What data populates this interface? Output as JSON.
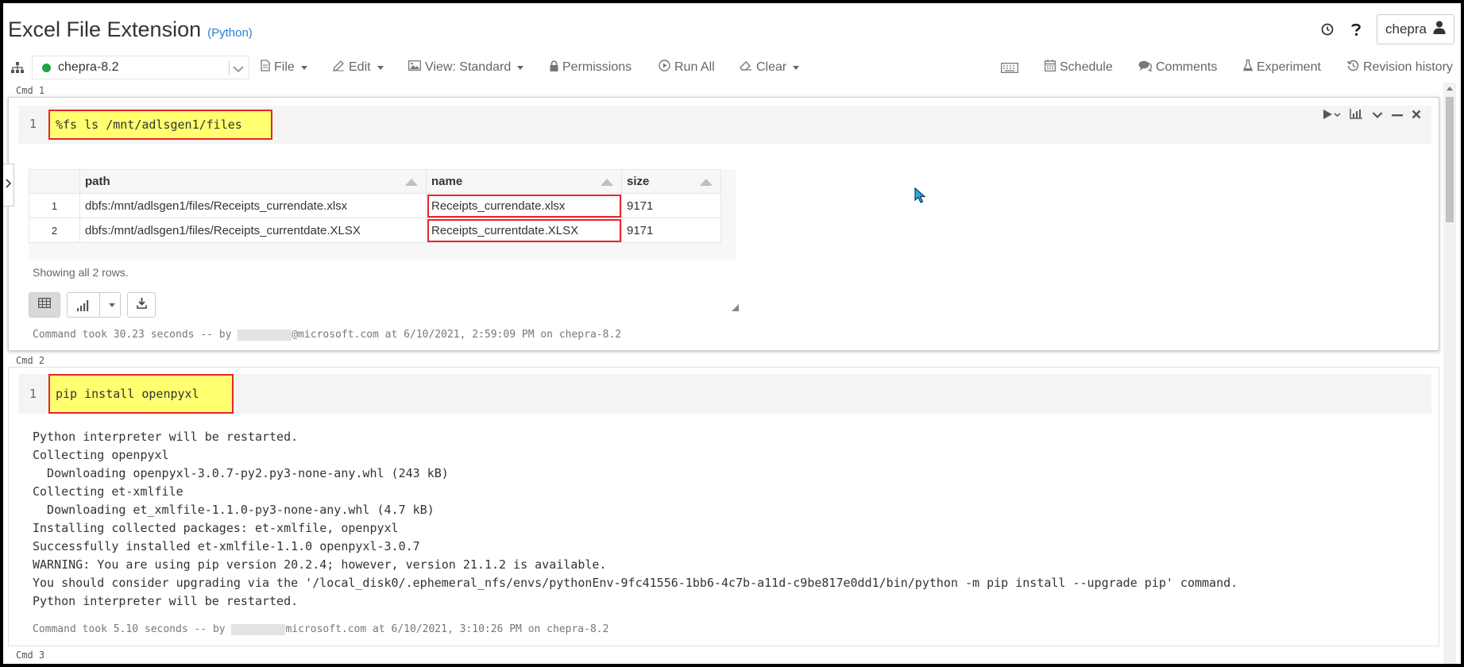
{
  "header": {
    "title": "Excel File Extension",
    "language": "(Python)",
    "user": "chepra"
  },
  "toolbar": {
    "cluster": "chepra-8.2",
    "file": "File",
    "edit": "Edit",
    "view": "View: Standard",
    "permissions": "Permissions",
    "run_all": "Run All",
    "clear": "Clear",
    "schedule": "Schedule",
    "comments": "Comments",
    "experiment": "Experiment",
    "revision_history": "Revision history"
  },
  "cmd1": {
    "label": "Cmd 1",
    "line_no": "1",
    "code": "%fs ls /mnt/adlsgen1/files",
    "table": {
      "headers": [
        "path",
        "name",
        "size"
      ],
      "rows": [
        {
          "n": "1",
          "path": "dbfs:/mnt/adlsgen1/files/Receipts_currendate.xlsx",
          "name": "Receipts_currendate.xlsx",
          "size": "9171"
        },
        {
          "n": "2",
          "path": "dbfs:/mnt/adlsgen1/files/Receipts_currentdate.XLSX",
          "name": "Receipts_currentdate.XLSX",
          "size": "9171"
        }
      ]
    },
    "showing": "Showing all 2 rows.",
    "took_prefix": "Command took 30.23 seconds -- by ",
    "took_suffix": "@microsoft.com at 6/10/2021, 2:59:09 PM on chepra-8.2"
  },
  "cmd2": {
    "label": "Cmd 2",
    "line_no": "1",
    "code": "pip install openpyxl",
    "output": [
      "Python interpreter will be restarted.",
      "Collecting openpyxl",
      "  Downloading openpyxl-3.0.7-py2.py3-none-any.whl (243 kB)",
      "Collecting et-xmlfile",
      "  Downloading et_xmlfile-1.1.0-py3-none-any.whl (4.7 kB)",
      "Installing collected packages: et-xmlfile, openpyxl",
      "Successfully installed et-xmlfile-1.1.0 openpyxl-3.0.7",
      "WARNING: You are using pip version 20.2.4; however, version 21.1.2 is available.",
      "You should consider upgrading via the '/local_disk0/.ephemeral_nfs/envs/pythonEnv-9fc41556-1bb6-4c7b-a11d-c9be817e0dd1/bin/python -m pip install --upgrade pip' command.",
      "Python interpreter will be restarted."
    ],
    "took_prefix": "Command took 5.10 seconds -- by ",
    "took_suffix": "microsoft.com at 6/10/2021, 3:10:26 PM on chepra-8.2"
  },
  "cmd3": {
    "label": "Cmd 3"
  },
  "colors": {
    "highlight": "#ffff6f",
    "highlight_border": "#e8242c",
    "status_ok": "#1fa54c",
    "link": "#2a7fd4"
  }
}
